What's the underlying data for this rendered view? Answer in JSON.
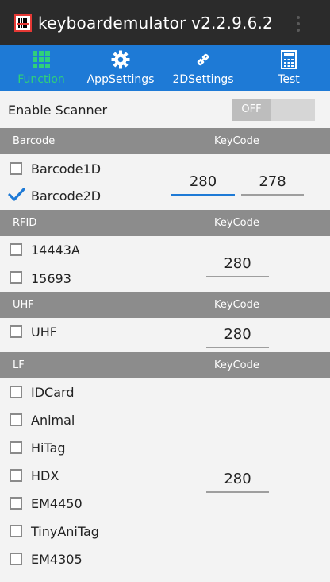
{
  "app": {
    "title": "keyboardemulator v2.2.9.6.2"
  },
  "tabs": [
    {
      "label": "Function",
      "icon": "grid-icon",
      "active": true
    },
    {
      "label": "AppSettings",
      "icon": "gear-icon",
      "active": false
    },
    {
      "label": "2DSettings",
      "icon": "link-icon",
      "active": false
    },
    {
      "label": "Test",
      "icon": "calculator-icon",
      "active": false
    }
  ],
  "enable_scanner": {
    "label": "Enable Scanner",
    "toggle_text": "OFF"
  },
  "sections": {
    "barcode": {
      "header": "Barcode",
      "keycode_header": "KeyCode",
      "items": [
        {
          "label": "Barcode1D",
          "checked": false
        },
        {
          "label": "Barcode2D",
          "checked": true
        }
      ],
      "keycodes": [
        "280",
        "278"
      ]
    },
    "rfid": {
      "header": "RFID",
      "keycode_header": "KeyCode",
      "items": [
        {
          "label": "14443A",
          "checked": false
        },
        {
          "label": "15693",
          "checked": false
        }
      ],
      "keycode": "280"
    },
    "uhf": {
      "header": "UHF",
      "keycode_header": "KeyCode",
      "items": [
        {
          "label": "UHF",
          "checked": false
        }
      ],
      "keycode": "280"
    },
    "lf": {
      "header": "LF",
      "keycode_header": "KeyCode",
      "items": [
        {
          "label": "IDCard",
          "checked": false
        },
        {
          "label": "Animal",
          "checked": false
        },
        {
          "label": "HiTag",
          "checked": false
        },
        {
          "label": "HDX",
          "checked": false
        },
        {
          "label": "EM4450",
          "checked": false
        },
        {
          "label": "TinyAniTag",
          "checked": false
        },
        {
          "label": "EM4305",
          "checked": false
        }
      ],
      "keycode": "280"
    }
  },
  "colors": {
    "tab_bg": "#1e7ad6",
    "active_tab": "#2fd07a",
    "check": "#1e7ad6"
  }
}
